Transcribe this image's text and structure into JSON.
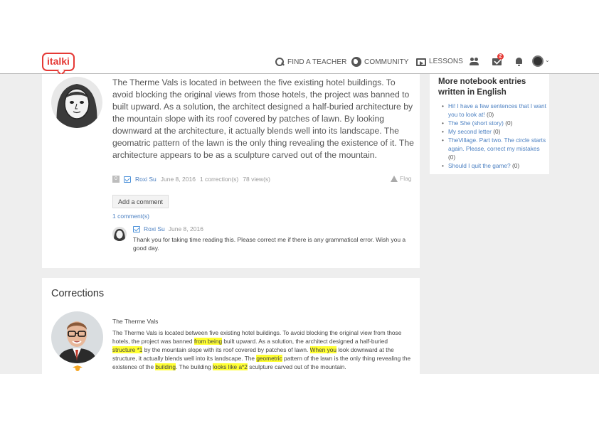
{
  "nav": {
    "logo": "italki",
    "find_teacher": "FIND A TEACHER",
    "community": "COMMUNITY",
    "lessons": "LESSONS",
    "messages_badge": "2"
  },
  "entry": {
    "text": "The Therme Vals is located in between the five existing hotel buildings. To avoid blocking the original views from those hotels, the project was banned to built upward. As a solution, the architect designed a half-buried architecture by the mountain slope with its roof covered by patches of lawn. By looking downward at the architecture, it actually blends well into its landscape. The geomatric pattern of the lawn is the only thing revealing the existence of it. The architecture appears to be as a sculpture carved out of the mountain.",
    "score": "0",
    "author": "Roxi Su",
    "date": "June 8, 2016",
    "corrections": "1 correction(s)",
    "views": "78 view(s)",
    "flag": "Flag",
    "add_comment": "Add a comment",
    "comments_count": "1 comment(s)"
  },
  "comment": {
    "author": "Roxi Su",
    "date": "June 8, 2016",
    "text": "Thank you for taking time reading this. Please correct me if there is any grammatical error. Wish you a good day."
  },
  "sidebar": {
    "title": "More notebook entries written in English",
    "items": [
      {
        "label": "Hi! I have a few sentences that I want you to look at!",
        "count": "(0)"
      },
      {
        "label": "The She (short story)",
        "count": "(0)"
      },
      {
        "label": "My second letter",
        "count": "(0)"
      },
      {
        "label": "TheVillage. Part two. The circle starts again. Please, correct my mistakes",
        "count": "(0)"
      },
      {
        "label": "Should I quit the game?",
        "count": "(0)"
      }
    ]
  },
  "corrections": {
    "title": "Corrections",
    "subtitle": "The Therme Vals",
    "segments": [
      {
        "t": "The Therme Vals is located between five existing hotel buildings. To avoid blocking the original view from those hotels, the project was banned ",
        "hl": false
      },
      {
        "t": "from being",
        "hl": true
      },
      {
        "t": " built upward. As a solution, the architect designed a half-buried ",
        "hl": false
      },
      {
        "t": "structure *1",
        "hl": true
      },
      {
        "t": " by the mountain slope with its roof covered by patches of lawn. ",
        "hl": false
      },
      {
        "t": "When you",
        "hl": true
      },
      {
        "t": " look downward at the structure, it actually blends well into its landscape. The ",
        "hl": false
      },
      {
        "t": "geometric",
        "hl": true
      },
      {
        "t": " pattern of the lawn is the only thing revealing the existence of the ",
        "hl": false
      },
      {
        "t": "building",
        "hl": true
      },
      {
        "t": ". The building ",
        "hl": false
      },
      {
        "t": "looks like a*2",
        "hl": true
      },
      {
        "t": " sculpture carved out of the mountain.",
        "hl": false
      }
    ]
  }
}
